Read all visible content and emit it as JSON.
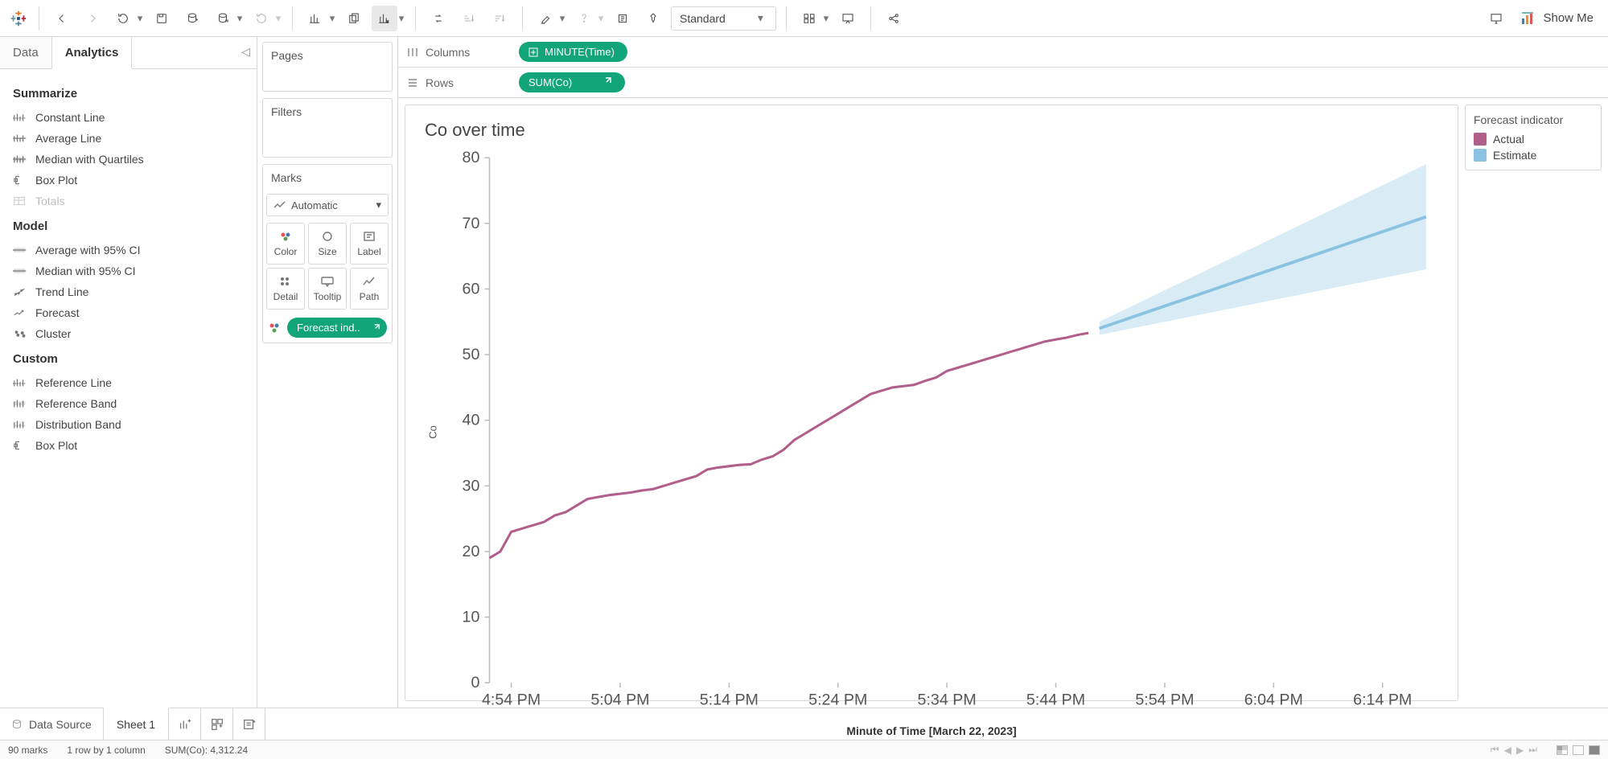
{
  "toolbar": {
    "fit_label": "Standard",
    "showme_label": "Show Me"
  },
  "sidebar": {
    "tabs": {
      "data": "Data",
      "analytics": "Analytics"
    },
    "sections": {
      "summarize": {
        "title": "Summarize",
        "items": [
          {
            "label": "Constant Line"
          },
          {
            "label": "Average Line"
          },
          {
            "label": "Median with Quartiles"
          },
          {
            "label": "Box Plot"
          },
          {
            "label": "Totals",
            "disabled": true
          }
        ]
      },
      "model": {
        "title": "Model",
        "items": [
          {
            "label": "Average with 95% CI"
          },
          {
            "label": "Median with 95% CI"
          },
          {
            "label": "Trend Line"
          },
          {
            "label": "Forecast"
          },
          {
            "label": "Cluster"
          }
        ]
      },
      "custom": {
        "title": "Custom",
        "items": [
          {
            "label": "Reference Line"
          },
          {
            "label": "Reference Band"
          },
          {
            "label": "Distribution Band"
          },
          {
            "label": "Box Plot"
          }
        ]
      }
    }
  },
  "cards": {
    "pages": "Pages",
    "filters": "Filters",
    "marks": {
      "title": "Marks",
      "type": "Automatic",
      "cells": [
        "Color",
        "Size",
        "Label",
        "Detail",
        "Tooltip",
        "Path"
      ],
      "pill": "Forecast ind.."
    }
  },
  "shelves": {
    "columns": {
      "label": "Columns",
      "pill": "MINUTE(Time)"
    },
    "rows": {
      "label": "Rows",
      "pill": "SUM(Co)"
    }
  },
  "viz": {
    "title": "Co over time",
    "ylabel": "Co",
    "xlabel": "Minute of Time [March 22, 2023]"
  },
  "legend": {
    "title": "Forecast indicator",
    "items": [
      {
        "label": "Actual",
        "color": "#b25e8a"
      },
      {
        "label": "Estimate",
        "color": "#8ac3e2"
      }
    ]
  },
  "bottom": {
    "data_source": "Data Source",
    "sheet": "Sheet 1"
  },
  "status": {
    "marks": "90 marks",
    "layout": "1 row by 1 column",
    "aggregate": "SUM(Co): 4,312.24"
  },
  "chart_data": {
    "type": "line",
    "title": "Co over time",
    "xlabel": "Minute of Time [March 22, 2023]",
    "ylabel": "Co",
    "ylim": [
      0,
      80
    ],
    "y_ticks": [
      0,
      10,
      20,
      30,
      40,
      50,
      60,
      70,
      80
    ],
    "x_ticks": [
      "4:54 PM",
      "5:04 PM",
      "5:14 PM",
      "5:24 PM",
      "5:34 PM",
      "5:44 PM",
      "5:54 PM",
      "6:04 PM",
      "6:14 PM"
    ],
    "x_range_minutes": [
      292,
      378
    ],
    "series": [
      {
        "name": "Actual",
        "color": "#b25e8a",
        "x": [
          292,
          293,
          294,
          295,
          296,
          297,
          298,
          299,
          300,
          301,
          302,
          303,
          304,
          305,
          306,
          307,
          308,
          309,
          310,
          311,
          312,
          313,
          314,
          315,
          316,
          317,
          318,
          319,
          320,
          321,
          322,
          323,
          324,
          325,
          326,
          327,
          328,
          329,
          330,
          331,
          332,
          333,
          334,
          335,
          336,
          337,
          338,
          339,
          340,
          341,
          342,
          343,
          344,
          345,
          346,
          347
        ],
        "y": [
          19,
          20,
          23,
          23.5,
          24,
          24.5,
          25.5,
          26,
          27,
          28,
          28.3,
          28.6,
          28.8,
          29,
          29.3,
          29.5,
          30,
          30.5,
          31,
          31.5,
          32.5,
          32.8,
          33,
          33.2,
          33.3,
          34,
          34.5,
          35.5,
          37,
          38,
          39,
          40,
          41,
          42,
          43,
          44,
          44.5,
          45,
          45.2,
          45.4,
          46,
          46.5,
          47.5,
          48,
          48.5,
          49,
          49.5,
          50,
          50.5,
          51,
          51.5,
          52,
          52.3,
          52.6,
          53,
          53.3
        ]
      },
      {
        "name": "Estimate",
        "color": "#8ac3e2",
        "x": [
          348,
          378
        ],
        "y": [
          54,
          71
        ],
        "ci_low": [
          53,
          63
        ],
        "ci_high": [
          55,
          79
        ]
      }
    ]
  }
}
